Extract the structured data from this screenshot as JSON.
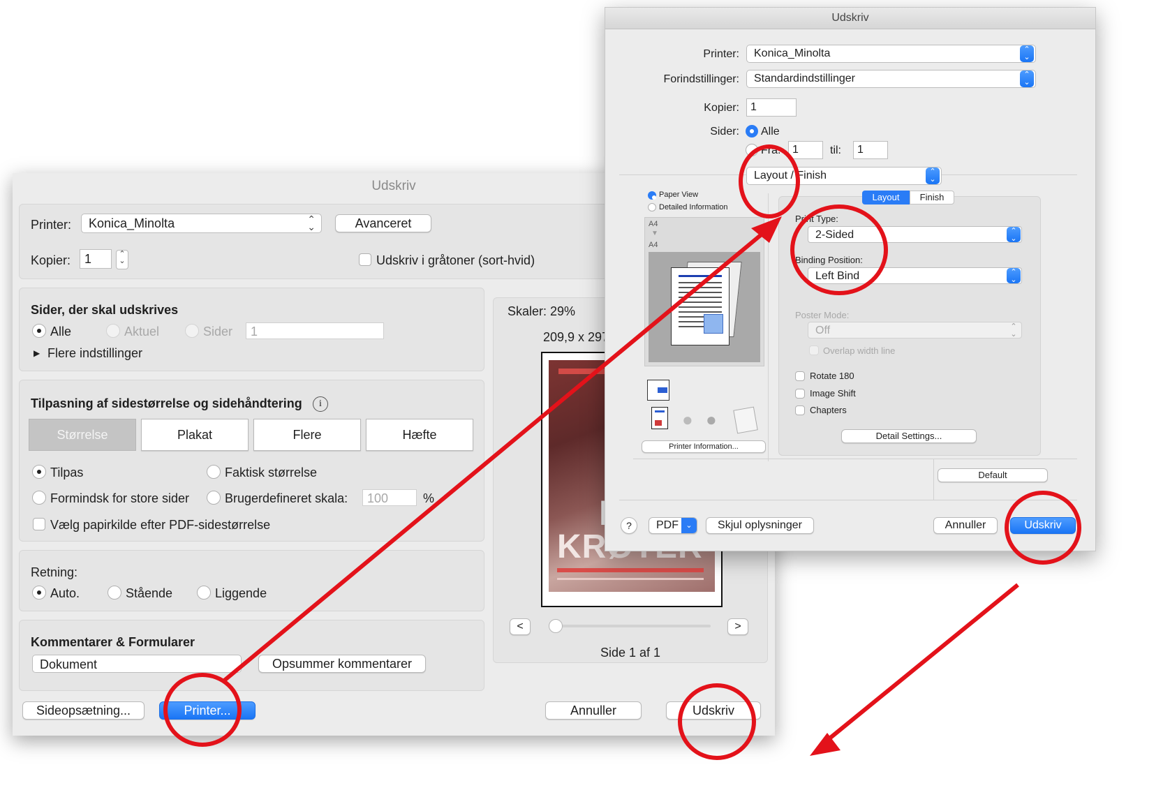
{
  "adobe": {
    "title": "Udskriv",
    "printer_label": "Printer:",
    "printer_value": "Konica_Minolta",
    "advanced_button": "Avanceret",
    "copies_label": "Kopier:",
    "copies_value": "1",
    "grayscale_label": "Udskriv i gråtoner (sort-hvid)",
    "pages_section": {
      "title": "Sider, der skal udskrives",
      "all": "Alle",
      "current": "Aktuel",
      "pages": "Sider",
      "pages_value": "1",
      "more": "Flere indstillinger"
    },
    "sizing_section": {
      "title": "Tilpasning af sidestørrelse og sidehåndtering",
      "tabs": [
        "Størrelse",
        "Plakat",
        "Flere",
        "Hæfte"
      ],
      "fit": "Tilpas",
      "actual": "Faktisk størrelse",
      "shrink": "Formindsk for store sider",
      "custom": "Brugerdefineret skala:",
      "custom_value": "100",
      "percent": "%",
      "paper_source": "Vælg papirkilde efter PDF-sidestørrelse"
    },
    "orientation": {
      "label": "Retning:",
      "auto": "Auto.",
      "portrait": "Stående",
      "landscape": "Liggende"
    },
    "comments": {
      "title": "Kommentarer & Formularer",
      "select_value": "Dokument",
      "summarize_button": "Opsummer kommentarer"
    },
    "preview": {
      "scale": "Skaler:  29%",
      "dimensions": "209,9 x 297",
      "prev": "<",
      "next": ">",
      "page": "Side 1 af 1",
      "poster_headline": "KRØTER",
      "poster_letter": "N"
    },
    "page_setup_button": "Sideopsætning...",
    "printer_button": "Printer...",
    "cancel_button": "Annuller",
    "print_button": "Udskriv"
  },
  "mac": {
    "title": "Udskriv",
    "printer_label": "Printer:",
    "printer_value": "Konica_Minolta",
    "presets_label": "Forindstillinger:",
    "presets_value": "Standardindstillinger",
    "copies_label": "Kopier:",
    "copies_value": "1",
    "pages_label": "Sider:",
    "pages_all": "Alle",
    "from_label": "Fra:",
    "from_value": "1",
    "to_label": "til:",
    "to_value": "1",
    "panel_select": "Layout / Finish",
    "paper_view": "Paper View",
    "detailed_info": "Detailed Information",
    "paper_a": "A4",
    "paper_b": "A4",
    "printer_info_button": "Printer Information...",
    "tabs": [
      "Layout",
      "Finish"
    ],
    "print_type_label": "Print Type:",
    "print_type_value": "2-Sided",
    "binding_label": "Binding Position:",
    "binding_value": "Left Bind",
    "poster_label": "Poster Mode:",
    "poster_value": "Off",
    "overlap": "Overlap width line",
    "rotate": "Rotate 180",
    "image_shift": "Image Shift",
    "chapters": "Chapters",
    "detail_button": "Detail Settings...",
    "default_button": "Default",
    "help": "?",
    "pdf": "PDF",
    "hide_details": "Skjul oplysninger",
    "cancel": "Annuller",
    "print": "Udskriv"
  },
  "colors": {
    "annotation": "#e3121a",
    "accent": "#1a75f5"
  }
}
